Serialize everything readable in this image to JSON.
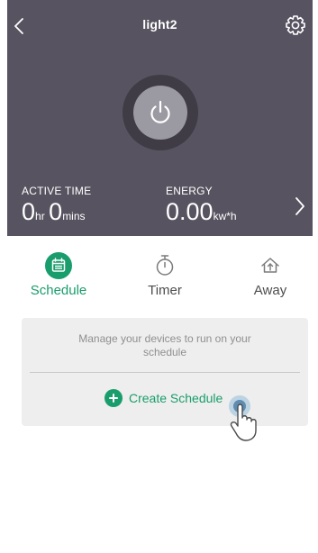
{
  "header": {
    "title": "light2",
    "back_icon": "chevron-left-icon",
    "settings_icon": "gear-icon",
    "power_icon": "power-icon",
    "next_icon": "chevron-right-icon",
    "background": "#575360"
  },
  "stats": {
    "active_time": {
      "label": "ACTIVE TIME",
      "hours": "0",
      "hours_unit": "hr",
      "minutes": "0",
      "minutes_unit": "mins"
    },
    "energy": {
      "label": "ENERGY",
      "value": "0.00",
      "unit": "kw*h"
    }
  },
  "tabs": [
    {
      "label": "Schedule",
      "icon": "calendar-icon",
      "active": true
    },
    {
      "label": "Timer",
      "icon": "stopwatch-icon",
      "active": false
    },
    {
      "label": "Away",
      "icon": "away-house-icon",
      "active": false
    }
  ],
  "schedule_card": {
    "description": "Manage your devices to run on your schedule",
    "create_label": "Create Schedule",
    "create_icon": "plus-circle-icon"
  },
  "colors": {
    "accent": "#1a9d6c",
    "card_background": "#eeeeee"
  }
}
